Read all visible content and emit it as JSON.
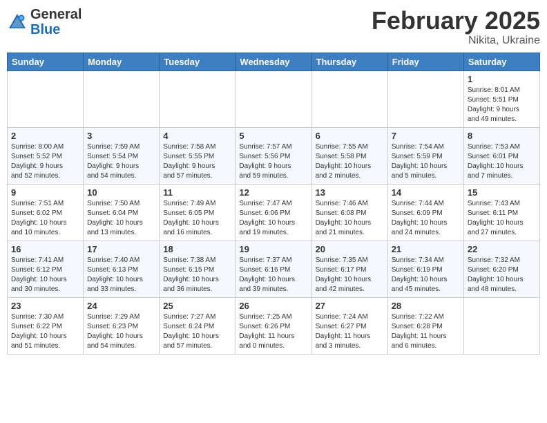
{
  "header": {
    "logo": {
      "general": "General",
      "blue": "Blue"
    },
    "title": "February 2025",
    "subtitle": "Nikita, Ukraine"
  },
  "weekdays": [
    "Sunday",
    "Monday",
    "Tuesday",
    "Wednesday",
    "Thursday",
    "Friday",
    "Saturday"
  ],
  "weeks": [
    [
      {
        "day": null,
        "info": null
      },
      {
        "day": null,
        "info": null
      },
      {
        "day": null,
        "info": null
      },
      {
        "day": null,
        "info": null
      },
      {
        "day": null,
        "info": null
      },
      {
        "day": null,
        "info": null
      },
      {
        "day": "1",
        "info": "Sunrise: 8:01 AM\nSunset: 5:51 PM\nDaylight: 9 hours\nand 49 minutes."
      }
    ],
    [
      {
        "day": "2",
        "info": "Sunrise: 8:00 AM\nSunset: 5:52 PM\nDaylight: 9 hours\nand 52 minutes."
      },
      {
        "day": "3",
        "info": "Sunrise: 7:59 AM\nSunset: 5:54 PM\nDaylight: 9 hours\nand 54 minutes."
      },
      {
        "day": "4",
        "info": "Sunrise: 7:58 AM\nSunset: 5:55 PM\nDaylight: 9 hours\nand 57 minutes."
      },
      {
        "day": "5",
        "info": "Sunrise: 7:57 AM\nSunset: 5:56 PM\nDaylight: 9 hours\nand 59 minutes."
      },
      {
        "day": "6",
        "info": "Sunrise: 7:55 AM\nSunset: 5:58 PM\nDaylight: 10 hours\nand 2 minutes."
      },
      {
        "day": "7",
        "info": "Sunrise: 7:54 AM\nSunset: 5:59 PM\nDaylight: 10 hours\nand 5 minutes."
      },
      {
        "day": "8",
        "info": "Sunrise: 7:53 AM\nSunset: 6:01 PM\nDaylight: 10 hours\nand 7 minutes."
      }
    ],
    [
      {
        "day": "9",
        "info": "Sunrise: 7:51 AM\nSunset: 6:02 PM\nDaylight: 10 hours\nand 10 minutes."
      },
      {
        "day": "10",
        "info": "Sunrise: 7:50 AM\nSunset: 6:04 PM\nDaylight: 10 hours\nand 13 minutes."
      },
      {
        "day": "11",
        "info": "Sunrise: 7:49 AM\nSunset: 6:05 PM\nDaylight: 10 hours\nand 16 minutes."
      },
      {
        "day": "12",
        "info": "Sunrise: 7:47 AM\nSunset: 6:06 PM\nDaylight: 10 hours\nand 19 minutes."
      },
      {
        "day": "13",
        "info": "Sunrise: 7:46 AM\nSunset: 6:08 PM\nDaylight: 10 hours\nand 21 minutes."
      },
      {
        "day": "14",
        "info": "Sunrise: 7:44 AM\nSunset: 6:09 PM\nDaylight: 10 hours\nand 24 minutes."
      },
      {
        "day": "15",
        "info": "Sunrise: 7:43 AM\nSunset: 6:11 PM\nDaylight: 10 hours\nand 27 minutes."
      }
    ],
    [
      {
        "day": "16",
        "info": "Sunrise: 7:41 AM\nSunset: 6:12 PM\nDaylight: 10 hours\nand 30 minutes."
      },
      {
        "day": "17",
        "info": "Sunrise: 7:40 AM\nSunset: 6:13 PM\nDaylight: 10 hours\nand 33 minutes."
      },
      {
        "day": "18",
        "info": "Sunrise: 7:38 AM\nSunset: 6:15 PM\nDaylight: 10 hours\nand 36 minutes."
      },
      {
        "day": "19",
        "info": "Sunrise: 7:37 AM\nSunset: 6:16 PM\nDaylight: 10 hours\nand 39 minutes."
      },
      {
        "day": "20",
        "info": "Sunrise: 7:35 AM\nSunset: 6:17 PM\nDaylight: 10 hours\nand 42 minutes."
      },
      {
        "day": "21",
        "info": "Sunrise: 7:34 AM\nSunset: 6:19 PM\nDaylight: 10 hours\nand 45 minutes."
      },
      {
        "day": "22",
        "info": "Sunrise: 7:32 AM\nSunset: 6:20 PM\nDaylight: 10 hours\nand 48 minutes."
      }
    ],
    [
      {
        "day": "23",
        "info": "Sunrise: 7:30 AM\nSunset: 6:22 PM\nDaylight: 10 hours\nand 51 minutes."
      },
      {
        "day": "24",
        "info": "Sunrise: 7:29 AM\nSunset: 6:23 PM\nDaylight: 10 hours\nand 54 minutes."
      },
      {
        "day": "25",
        "info": "Sunrise: 7:27 AM\nSunset: 6:24 PM\nDaylight: 10 hours\nand 57 minutes."
      },
      {
        "day": "26",
        "info": "Sunrise: 7:25 AM\nSunset: 6:26 PM\nDaylight: 11 hours\nand 0 minutes."
      },
      {
        "day": "27",
        "info": "Sunrise: 7:24 AM\nSunset: 6:27 PM\nDaylight: 11 hours\nand 3 minutes."
      },
      {
        "day": "28",
        "info": "Sunrise: 7:22 AM\nSunset: 6:28 PM\nDaylight: 11 hours\nand 6 minutes."
      },
      {
        "day": null,
        "info": null
      }
    ]
  ]
}
